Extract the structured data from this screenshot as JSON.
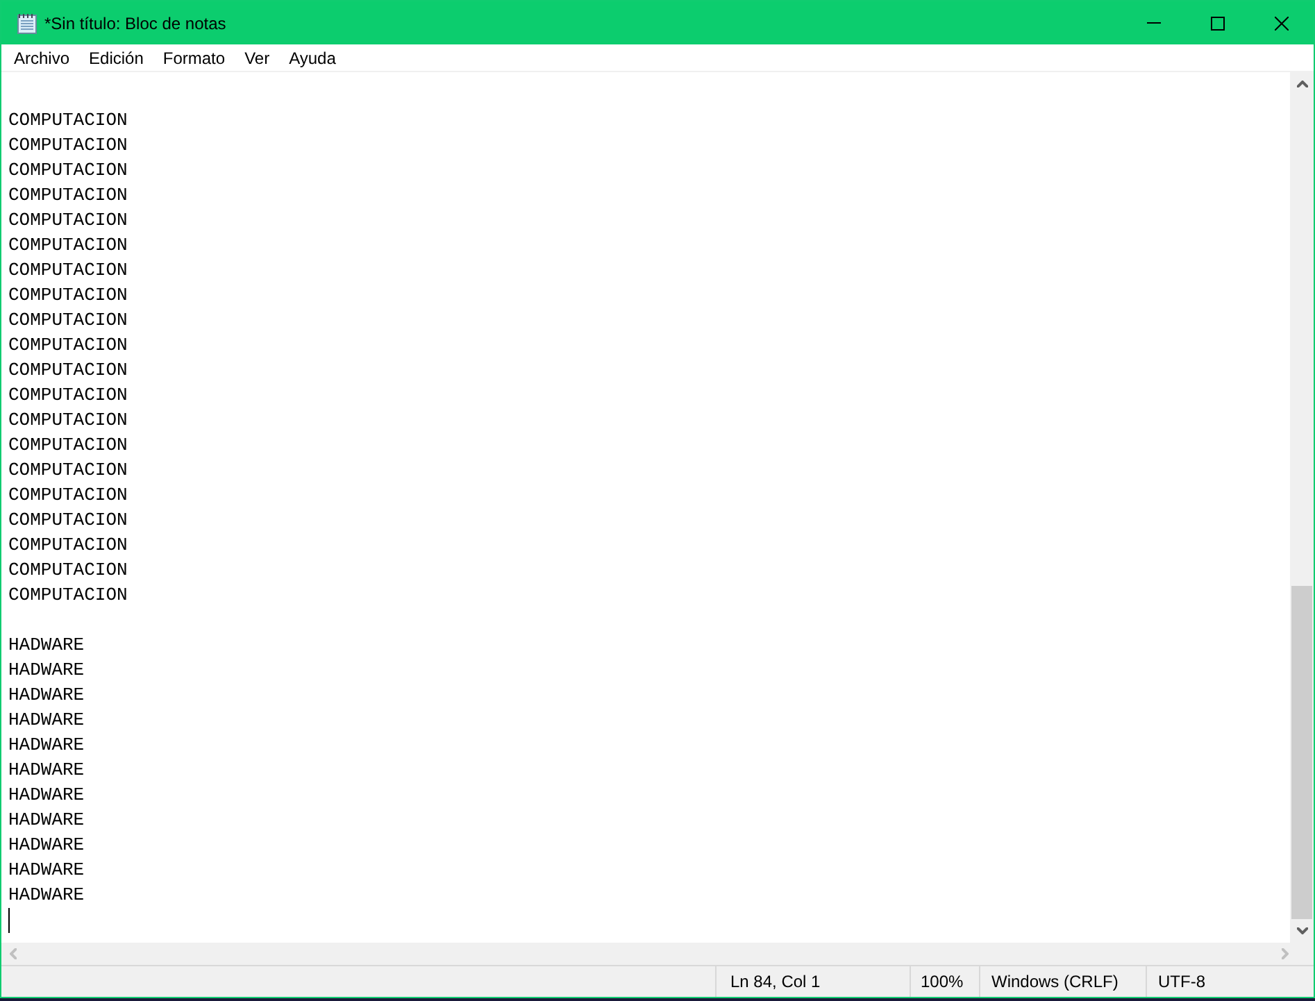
{
  "window": {
    "title": "*Sin título: Bloc de notas"
  },
  "menu": [
    "Archivo",
    "Edición",
    "Formato",
    "Ver",
    "Ayuda"
  ],
  "editor": {
    "text": "\nCOMPUTACION\nCOMPUTACION\nCOMPUTACION\nCOMPUTACION\nCOMPUTACION\nCOMPUTACION\nCOMPUTACION\nCOMPUTACION\nCOMPUTACION\nCOMPUTACION\nCOMPUTACION\nCOMPUTACION\nCOMPUTACION\nCOMPUTACION\nCOMPUTACION\nCOMPUTACION\nCOMPUTACION\nCOMPUTACION\nCOMPUTACION\nCOMPUTACION\n\nHADWARE\nHADWARE\nHADWARE\nHADWARE\nHADWARE\nHADWARE\nHADWARE\nHADWARE\nHADWARE\nHADWARE\nHADWARE"
  },
  "status_bar": {
    "position": "Ln 84, Col 1",
    "zoom": "100%",
    "line_ending": "Windows (CRLF)",
    "encoding": "UTF-8"
  }
}
